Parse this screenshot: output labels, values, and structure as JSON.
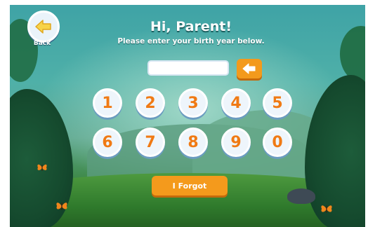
{
  "header": {
    "back_label": "Back",
    "title": "Hi, Parent!",
    "subtitle": "Please enter your birth year below."
  },
  "entry": {
    "value": ""
  },
  "keypad": {
    "row1": [
      "1",
      "2",
      "3",
      "4",
      "5"
    ],
    "row2": [
      "6",
      "7",
      "8",
      "9",
      "0"
    ]
  },
  "forgot_label": "I Forgot",
  "colors": {
    "accent_orange": "#f39a1c",
    "digit_orange": "#f07a14",
    "key_face": "#eef5fb",
    "back_arrow": "#f7d34a"
  },
  "icons": {
    "back": "arrow-left-icon",
    "delete": "backspace-arrow-icon",
    "decor": "butterfly-icon"
  }
}
